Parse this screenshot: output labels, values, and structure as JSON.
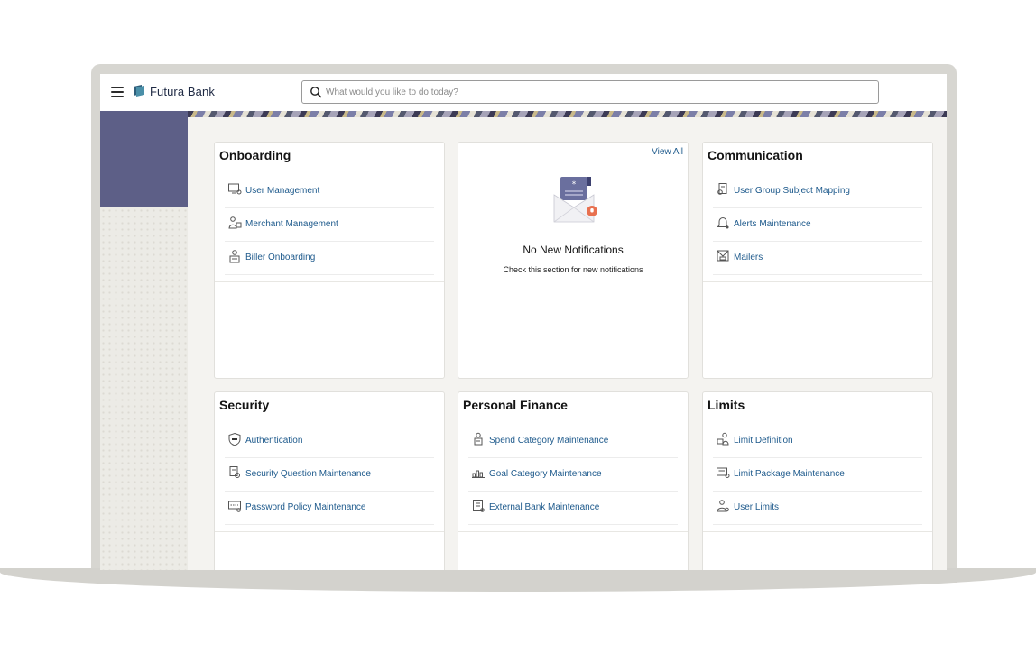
{
  "header": {
    "brand": "Futura Bank",
    "search_placeholder": "What would you like to do today?"
  },
  "cards": {
    "onboarding": {
      "title": "Onboarding",
      "items": [
        {
          "label": "User Management",
          "icon": "user-management-icon"
        },
        {
          "label": "Merchant Management",
          "icon": "merchant-icon"
        },
        {
          "label": "Biller Onboarding",
          "icon": "biller-icon"
        }
      ]
    },
    "notifications": {
      "view_all": "View All",
      "title": "No New Notifications",
      "subtitle": "Check this section for new notifications"
    },
    "communication": {
      "title": "Communication",
      "items": [
        {
          "label": "User Group Subject Mapping",
          "icon": "subject-mapping-icon"
        },
        {
          "label": "Alerts Maintenance",
          "icon": "bell-icon"
        },
        {
          "label": "Mailers",
          "icon": "mailer-icon"
        }
      ]
    },
    "security": {
      "title": "Security",
      "items": [
        {
          "label": "Authentication",
          "icon": "shield-icon"
        },
        {
          "label": "Security Question Maintenance",
          "icon": "security-question-icon"
        },
        {
          "label": "Password Policy Maintenance",
          "icon": "password-policy-icon"
        }
      ]
    },
    "personal_finance": {
      "title": "Personal Finance",
      "items": [
        {
          "label": "Spend Category Maintenance",
          "icon": "spend-category-icon"
        },
        {
          "label": "Goal Category Maintenance",
          "icon": "goal-category-icon"
        },
        {
          "label": "External Bank Maintenance",
          "icon": "external-bank-icon"
        }
      ]
    },
    "limits": {
      "title": "Limits",
      "items": [
        {
          "label": "Limit Definition",
          "icon": "limit-definition-icon"
        },
        {
          "label": "Limit Package Maintenance",
          "icon": "limit-package-icon"
        },
        {
          "label": "User Limits",
          "icon": "user-limits-icon"
        }
      ]
    }
  },
  "colors": {
    "accent_link": "#1e5a8c",
    "side_panel": "#5d5f87",
    "badge": "#e8704f"
  }
}
